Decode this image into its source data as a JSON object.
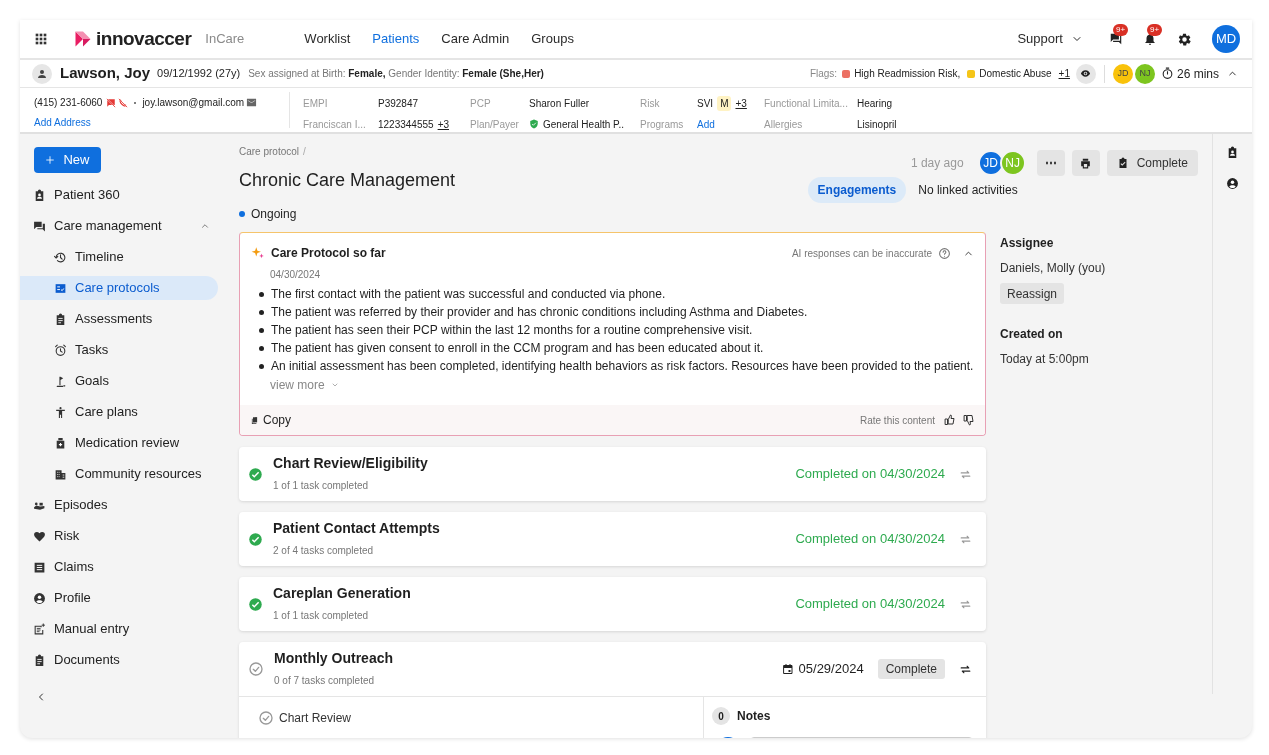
{
  "brand": {
    "name": "innovaccer",
    "product": "InCare"
  },
  "nav": [
    {
      "label": "Worklist",
      "selected": false
    },
    {
      "label": "Patients",
      "selected": true
    },
    {
      "label": "Care Admin",
      "selected": false
    },
    {
      "label": "Groups",
      "selected": false
    }
  ],
  "top_right": {
    "support": "Support",
    "notifications": [
      {
        "kind": "messages",
        "badge": "9+"
      },
      {
        "kind": "alerts",
        "badge": "9+"
      }
    ],
    "user": "MD"
  },
  "patient": {
    "name": "Lawson, Joy",
    "dob": "09/12/1992 (27y)",
    "sex_label": "Sex assigned at Birth:",
    "sex": "Female,",
    "gender_label": "Gender Identity:",
    "gender": "Female (She,Her)",
    "flags_label": "Flags:",
    "flags": [
      {
        "label": "High Readmission Risk,",
        "color": "#ec7063"
      },
      {
        "label": "Domestic Abuse",
        "color": "#f5c518"
      }
    ],
    "flags_more": "+1",
    "care_team": [
      {
        "initials": "JD",
        "color": "#f9c20a"
      },
      {
        "initials": "NJ",
        "color": "#7dc51f"
      }
    ],
    "timer": "26 mins",
    "expanded": true,
    "phone": "(415) 231-6060",
    "email": "joy.lawson@gmail.com",
    "add_address": "Add Address",
    "fields": [
      {
        "kind": "text",
        "label": "EMPI",
        "value": "P392847"
      },
      {
        "kind": "text",
        "label": "PCP",
        "value": "Sharon Fuller"
      },
      {
        "kind": "badge",
        "label": "Risk",
        "value": "SVI",
        "badge": "M",
        "more": "+3"
      },
      {
        "kind": "text",
        "label": "Functional Limita...",
        "value": "Hearing"
      },
      {
        "kind": "text",
        "label": "Franciscan I...",
        "value": "1223344555",
        "more": "+3"
      },
      {
        "kind": "payer",
        "label": "Plan/Payer",
        "value": "General Health P.."
      },
      {
        "kind": "link",
        "label": "Programs",
        "value": "Add"
      },
      {
        "kind": "text",
        "label": "Allergies",
        "value": "Lisinopril"
      }
    ]
  },
  "sidebar": {
    "new_button": "New",
    "items": [
      {
        "label": "Patient 360",
        "selected": false
      },
      {
        "label": "Care management",
        "selected": false,
        "expanded": true,
        "children": [
          {
            "label": "Timeline",
            "selected": false
          },
          {
            "label": "Care protocols",
            "selected": true
          },
          {
            "label": "Assessments",
            "selected": false
          },
          {
            "label": "Tasks",
            "selected": false
          },
          {
            "label": "Goals",
            "selected": false
          },
          {
            "label": "Care plans",
            "selected": false
          },
          {
            "label": "Medication review",
            "selected": false
          },
          {
            "label": "Community resources",
            "selected": false
          }
        ]
      },
      {
        "label": "Episodes",
        "selected": false
      },
      {
        "label": "Risk",
        "selected": false
      },
      {
        "label": "Claims",
        "selected": false
      },
      {
        "label": "Profile",
        "selected": false
      },
      {
        "label": "Manual entry",
        "selected": false
      },
      {
        "label": "Documents",
        "selected": false
      }
    ]
  },
  "header": {
    "breadcrumb": "Care protocol",
    "separator": "/",
    "title": "Chronic Care Management",
    "updated": "1 day ago",
    "assignees": [
      {
        "initials": "JD",
        "color": "#0f6fde"
      },
      {
        "initials": "NJ",
        "color": "#7dc51f"
      }
    ],
    "more_button": "⋯",
    "complete_button": "Complete",
    "engagements": "Engagements",
    "linked": "No linked activities",
    "status": "Ongoing"
  },
  "summary": {
    "title": "Care Protocol so far",
    "disclaimer": "AI responses can be inaccurate",
    "expanded": true,
    "date": "04/30/2024",
    "bullets": [
      "The first contact with the patient was successful and conducted via phone.",
      "The patient was referred by their provider and has chronic conditions including Asthma and Diabetes.",
      "The patient has seen their PCP within the last 12 months for a routine comprehensive visit.",
      "The patient has given consent to enroll in the CCM program and has been educated about it.",
      "An initial assessment has been completed, identifying health behaviors as risk factors. Resources have been provided to the patient."
    ],
    "view_more": "view more",
    "copy": "Copy",
    "rate": "Rate this content"
  },
  "steps": [
    {
      "kind": "completed",
      "title": "Chart Review/Eligibility",
      "subtitle": "1 of 1 task completed",
      "status": "Completed on 04/30/2024"
    },
    {
      "kind": "completed",
      "title": "Patient Contact Attempts",
      "subtitle": "2 of 4 tasks completed",
      "status": "Completed on 04/30/2024"
    },
    {
      "kind": "completed",
      "title": "Careplan Generation",
      "subtitle": "1 of 1 task completed",
      "status": "Completed on 04/30/2024"
    },
    {
      "kind": "pending",
      "title": "Monthly Outreach",
      "subtitle": "0 of 7 tasks completed",
      "due": "05/29/2024",
      "action": "Complete",
      "expanded": true,
      "tasks": [
        {
          "label": "Chart Review",
          "done": false
        }
      ],
      "notes": {
        "count": "0",
        "label": "Notes"
      }
    }
  ],
  "details": {
    "assignee_label": "Assignee",
    "assignee": "Daniels, Molly (you)",
    "reassign": "Reassign",
    "created_label": "Created on",
    "created": "Today at 5:00pm"
  }
}
